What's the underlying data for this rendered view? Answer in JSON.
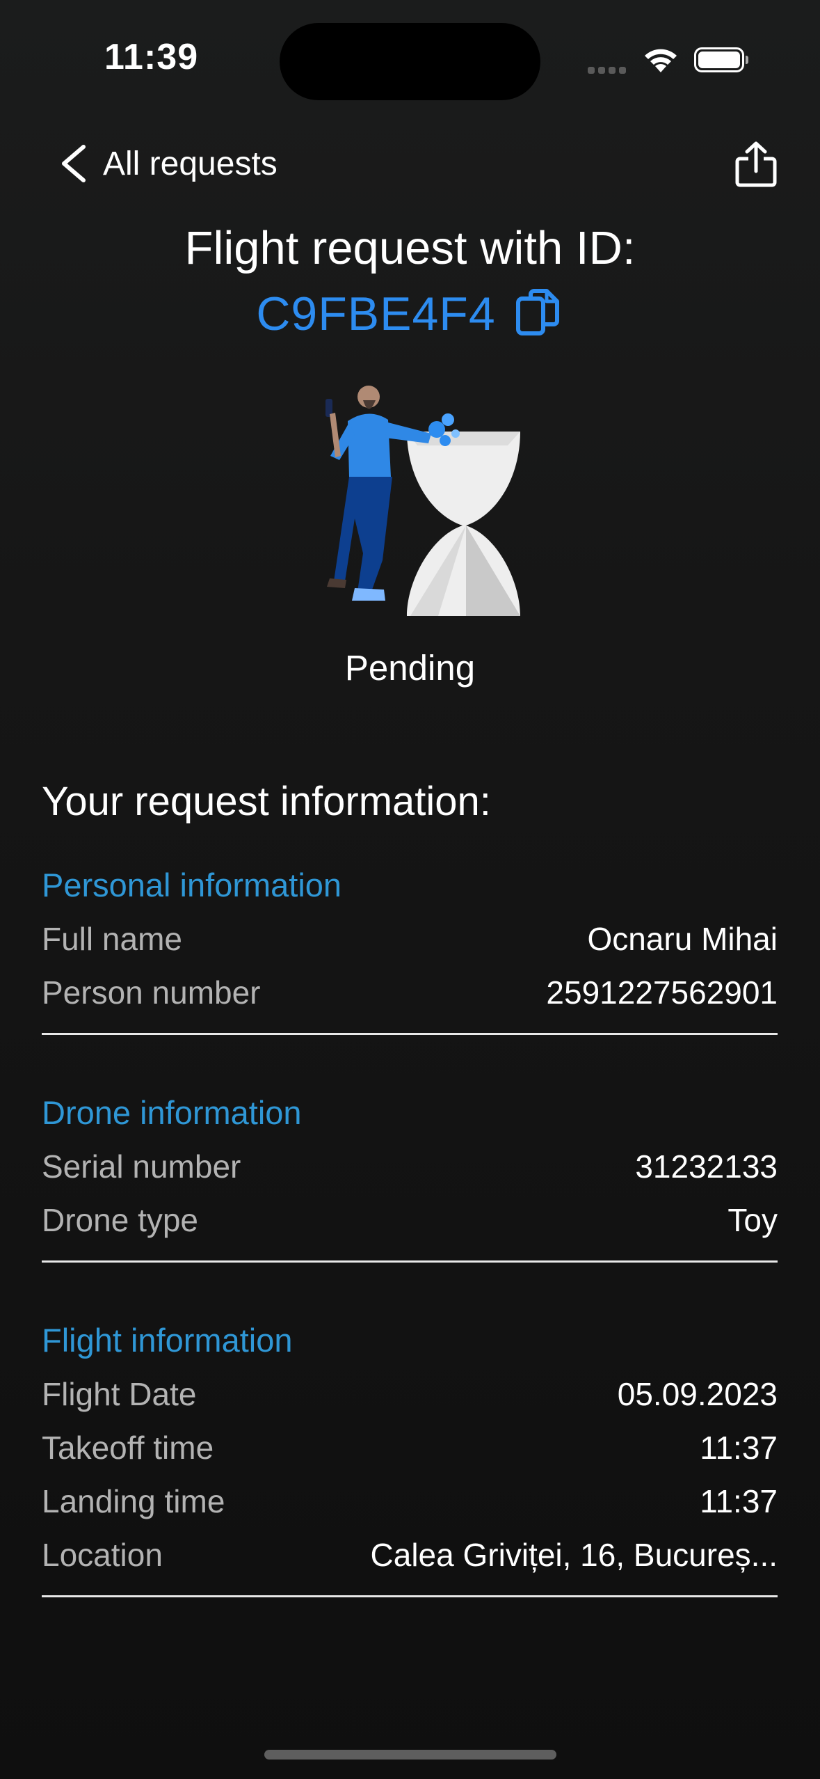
{
  "status_bar": {
    "time": "11:39"
  },
  "nav": {
    "back_label": "All requests"
  },
  "header": {
    "title": "Flight request with ID:",
    "request_id": "C9FBE4F4"
  },
  "status": {
    "label": "Pending"
  },
  "info": {
    "heading": "Your request information:",
    "personal": {
      "title": "Personal information",
      "rows": [
        {
          "label": "Full name",
          "value": "Ocnaru Mihai"
        },
        {
          "label": "Person number",
          "value": "2591227562901"
        }
      ]
    },
    "drone": {
      "title": "Drone information",
      "rows": [
        {
          "label": "Serial number",
          "value": "31232133"
        },
        {
          "label": "Drone type",
          "value": "Toy"
        }
      ]
    },
    "flight": {
      "title": "Flight information",
      "rows": [
        {
          "label": "Flight Date",
          "value": "05.09.2023"
        },
        {
          "label": "Takeoff time",
          "value": "11:37"
        },
        {
          "label": "Landing time",
          "value": "11:37"
        },
        {
          "label": "Location",
          "value": "Calea Griviței, 16, Bucureș..."
        }
      ]
    }
  },
  "colors": {
    "accent_id": "#2d8cf0",
    "section_title": "#2f97d6",
    "label": "#b3b3b3"
  }
}
